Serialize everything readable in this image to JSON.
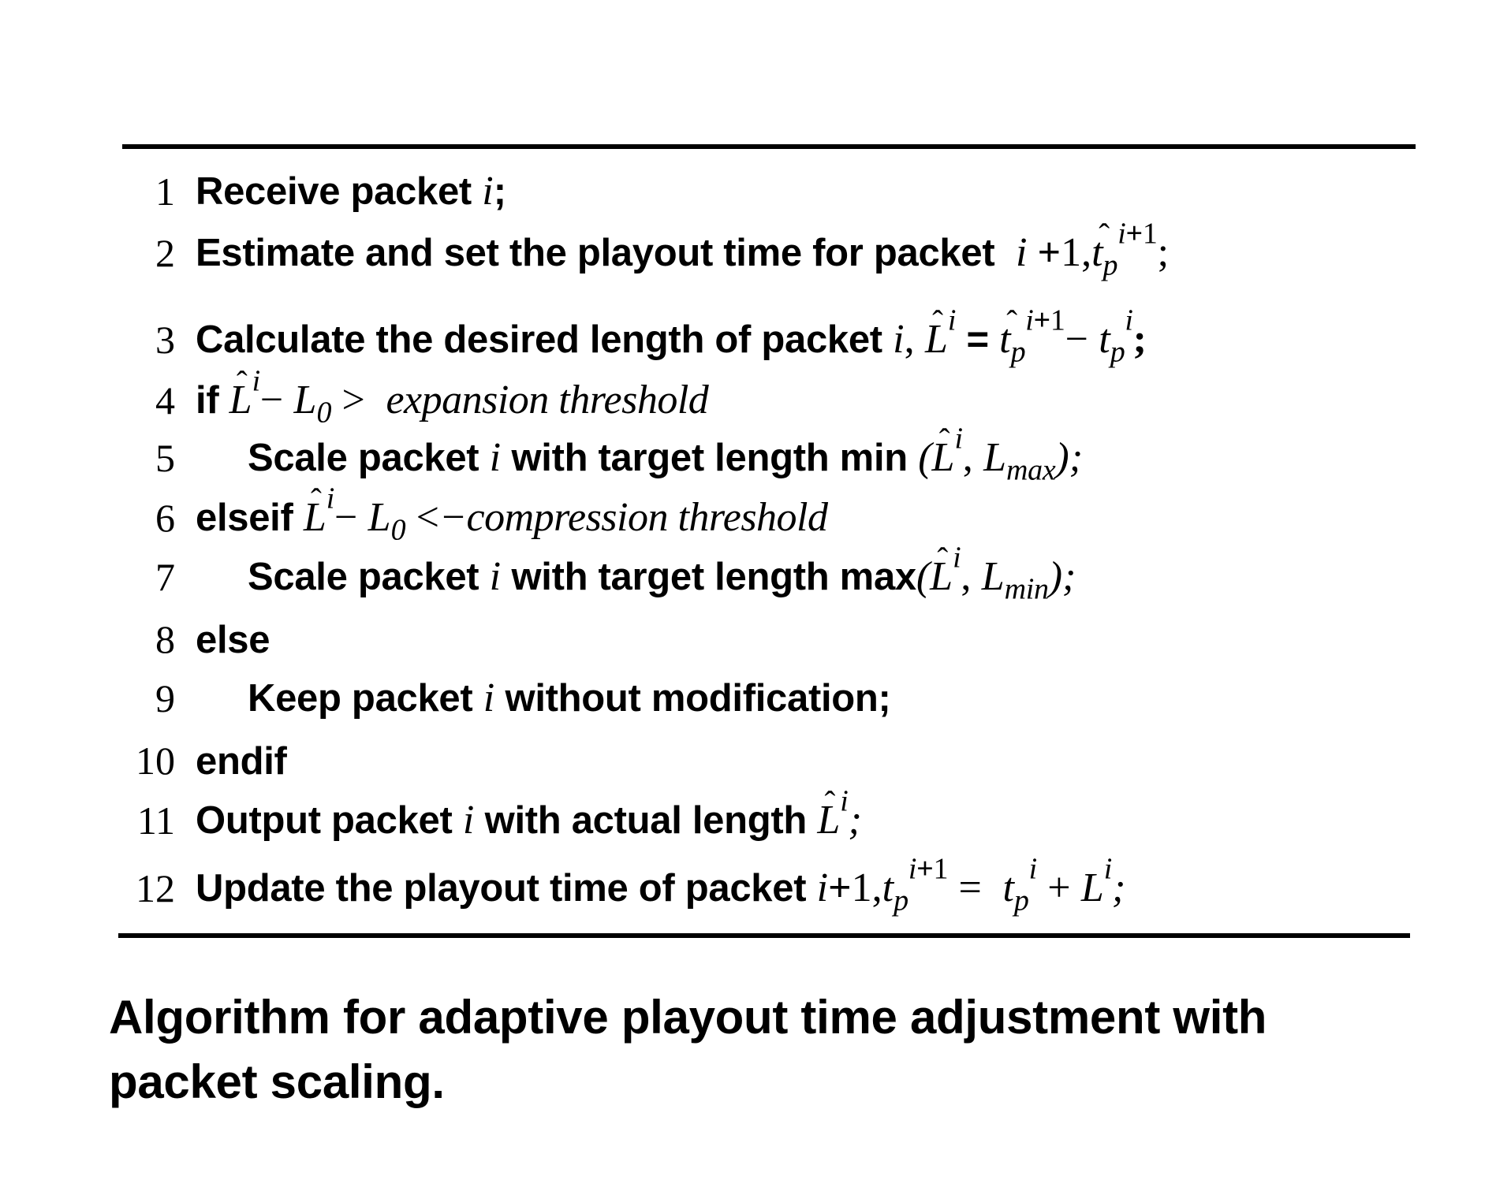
{
  "algorithm": {
    "lines": [
      {
        "num": "1",
        "text": "Receive packet",
        "var": "i",
        "tail": ";"
      },
      {
        "num": "2",
        "text": "Estimate and set the playout time for packet",
        "expr": "i + 1, t̂p^(i+1);"
      },
      {
        "num": "3",
        "text": "Calculate the desired length of packet",
        "expr": "i, L̂^i = t̂p^(i+1) − tp^i;"
      },
      {
        "num": "4",
        "kw": "if",
        "expr": "L̂^i − L0 >",
        "cond": "expansion threshold"
      },
      {
        "num": "5",
        "text": "Scale packet",
        "var": "i",
        "text2": "with target length min",
        "expr": "(L̂^i, Lmax);"
      },
      {
        "num": "6",
        "kw": "elseif",
        "expr": "L̂^i − L0 <",
        "cond": "−compression threshold"
      },
      {
        "num": "7",
        "text": "Scale packet",
        "var": "i",
        "text2": "with target length max",
        "expr": "(L̂^i, Lmin);"
      },
      {
        "num": "8",
        "kw": "else"
      },
      {
        "num": "9",
        "text": "Keep packet",
        "var": "i",
        "text2": "without modification;"
      },
      {
        "num": "10",
        "kw": "endif"
      },
      {
        "num": "11",
        "text": "Output packet",
        "var": "i",
        "text2": "with actual length",
        "expr": "L̂^i;"
      },
      {
        "num": "12",
        "text": "Update the playout time of packet",
        "expr": "i + 1, tp^(i+1) = tp^i + L^i;"
      }
    ],
    "symbols": {
      "i": "i",
      "one": "1",
      "plus": "+",
      "minus": "−",
      "eq": "=",
      "gt": ">",
      "lt": "<",
      "comma": ",",
      "semi": ";",
      "L": "L",
      "t": "t",
      "p": "p",
      "zero": "0",
      "ip1": "i+1",
      "max": "max",
      "min": "min",
      "lparen": "(",
      "rparen": ")"
    }
  },
  "caption": {
    "line1": "Algorithm for adaptive playout time adjustment with",
    "line2": "packet scaling."
  }
}
